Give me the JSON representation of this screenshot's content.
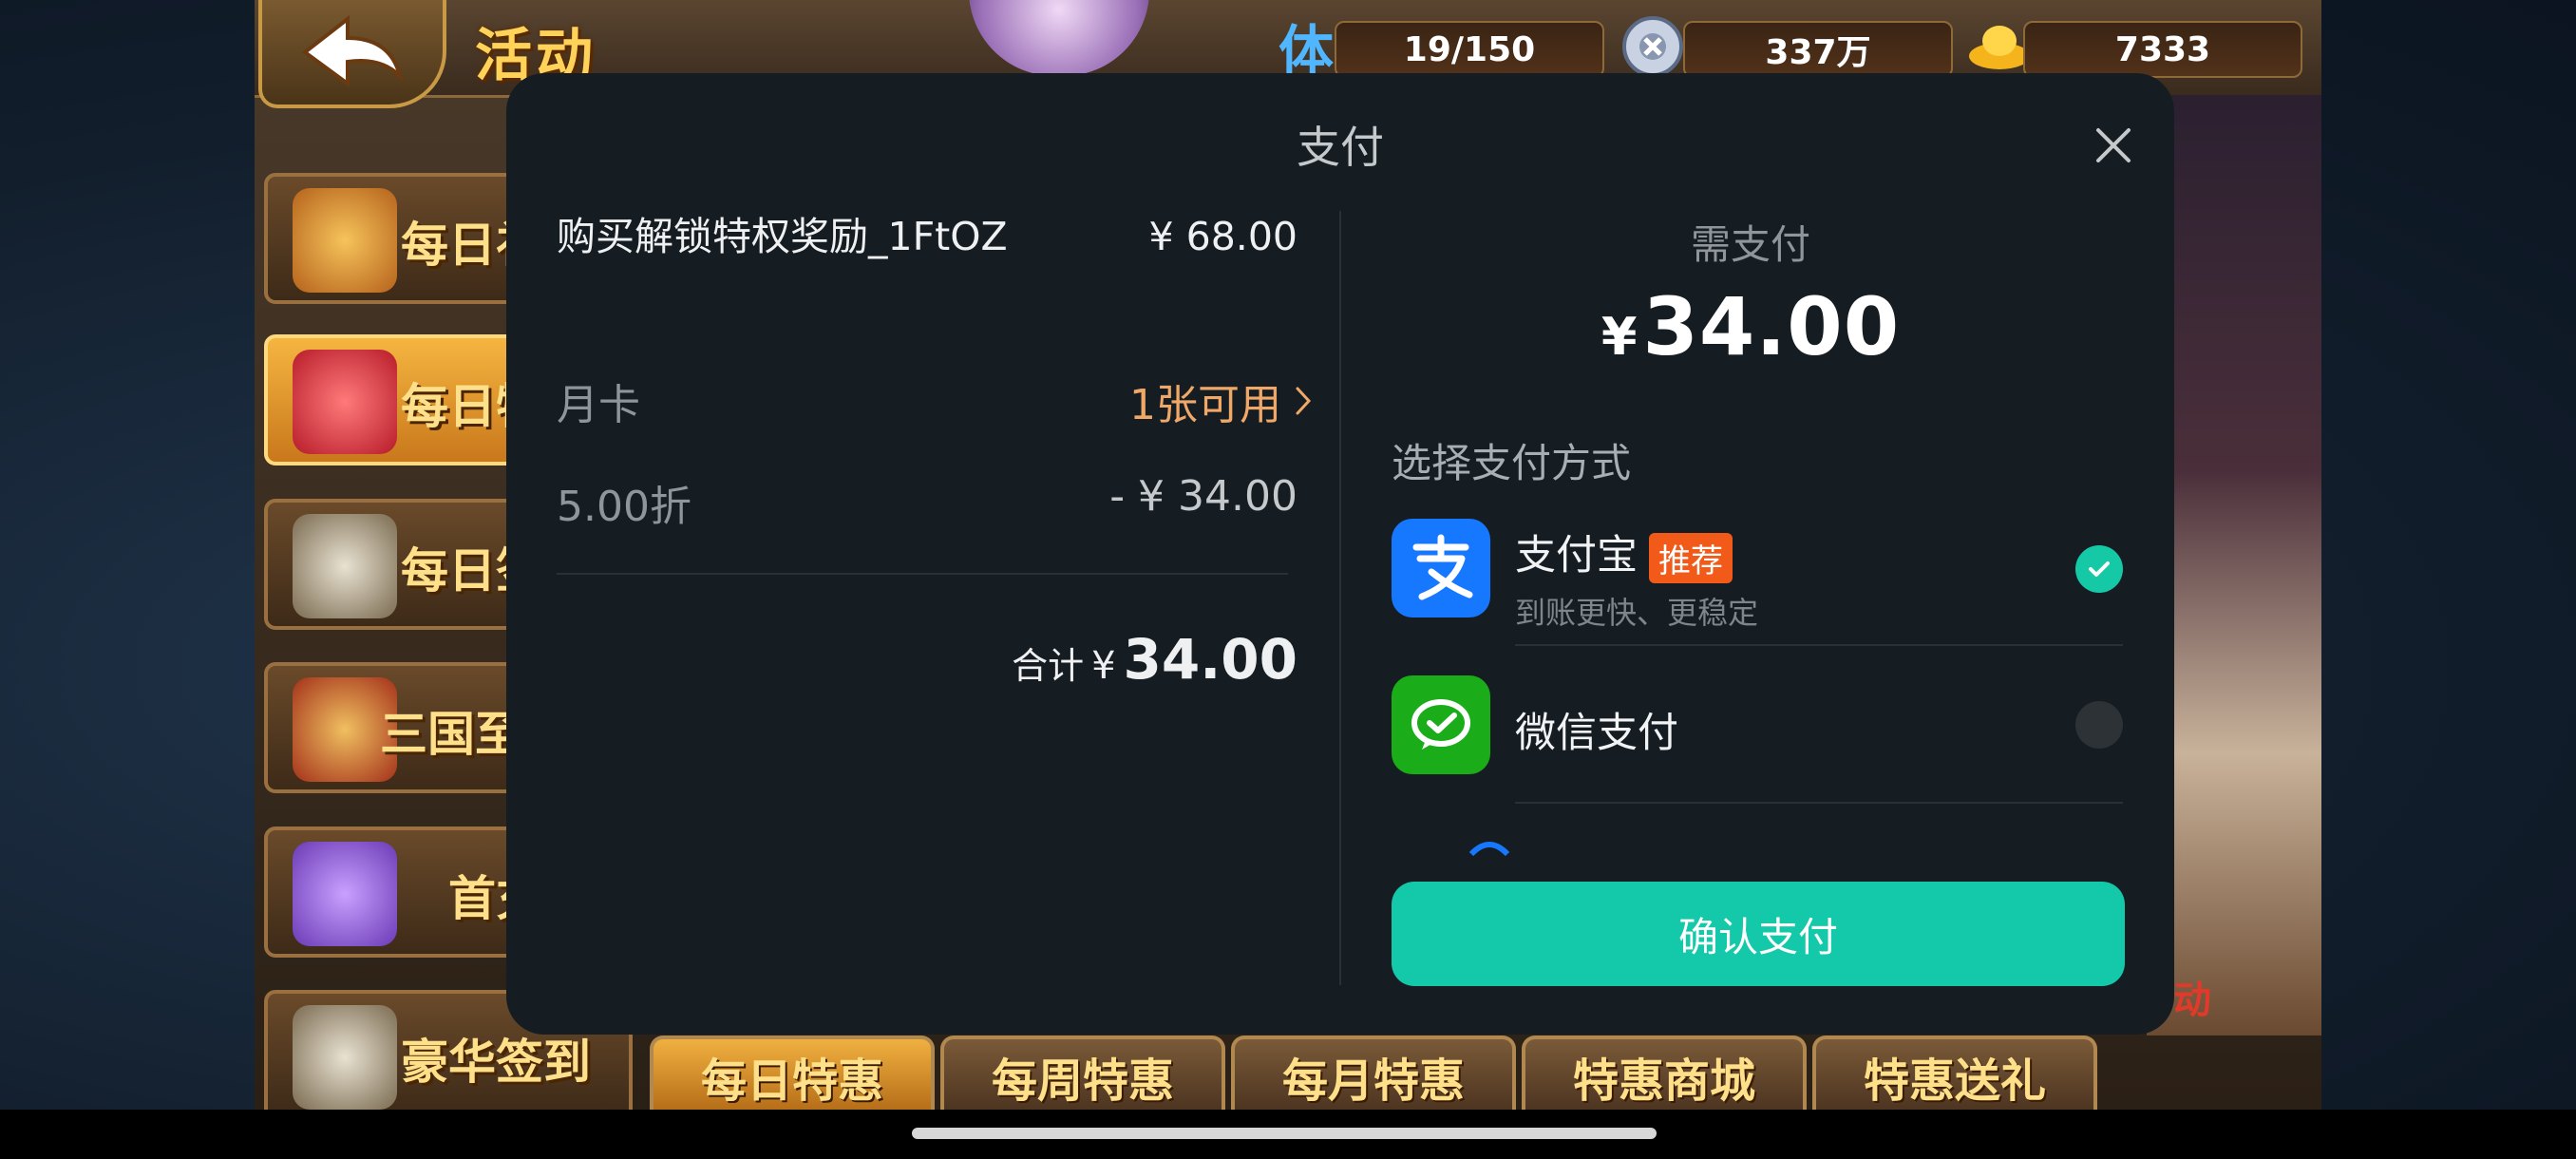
{
  "game": {
    "title": "活动",
    "resources": {
      "stamina_icon": "体",
      "stamina": "19/150",
      "silver": "337万",
      "gold": "7333"
    },
    "side_menu": [
      {
        "label": "每日礼",
        "active": false
      },
      {
        "label": "每日特",
        "active": true
      },
      {
        "label": "每日签",
        "active": false
      },
      {
        "label": "三国至",
        "active": false
      },
      {
        "label": "首充",
        "active": false
      },
      {
        "label": "豪华签到",
        "active": false
      }
    ],
    "tabs": [
      {
        "label": "每日特惠",
        "active": true
      },
      {
        "label": "每周特惠",
        "active": false
      },
      {
        "label": "每月特惠",
        "active": false
      },
      {
        "label": "特惠商城",
        "active": false
      },
      {
        "label": "特惠送礼",
        "active": false
      }
    ],
    "scene_text": "动"
  },
  "payment": {
    "title": "支付",
    "product_name": "购买解锁特权奖励_1FtOZ",
    "product_price": "¥ 68.00",
    "card_label": "月卡",
    "card_value": "1张可用",
    "discount_label": "5.00折",
    "discount_value": "- ¥ 34.00",
    "total_label": "合计",
    "total_currency": "¥",
    "total_amount": "34.00",
    "need_pay_label": "需支付",
    "need_pay_currency": "¥",
    "need_pay_amount": "34.00",
    "method_title": "选择支付方式",
    "methods": [
      {
        "name": "支付宝",
        "badge": "推荐",
        "subtitle": "到账更快、更稳定",
        "selected": true,
        "icon": "alipay-icon"
      },
      {
        "name": "微信支付",
        "selected": false,
        "icon": "wechat-pay-icon"
      }
    ],
    "confirm_label": "确认支付"
  },
  "colors": {
    "modal_bg": "#161d22",
    "accent": "#13c9aa",
    "card_value": "#f0a868",
    "badge": "#f25a1a",
    "alipay": "#1677ff",
    "wechat": "#1aad19"
  }
}
